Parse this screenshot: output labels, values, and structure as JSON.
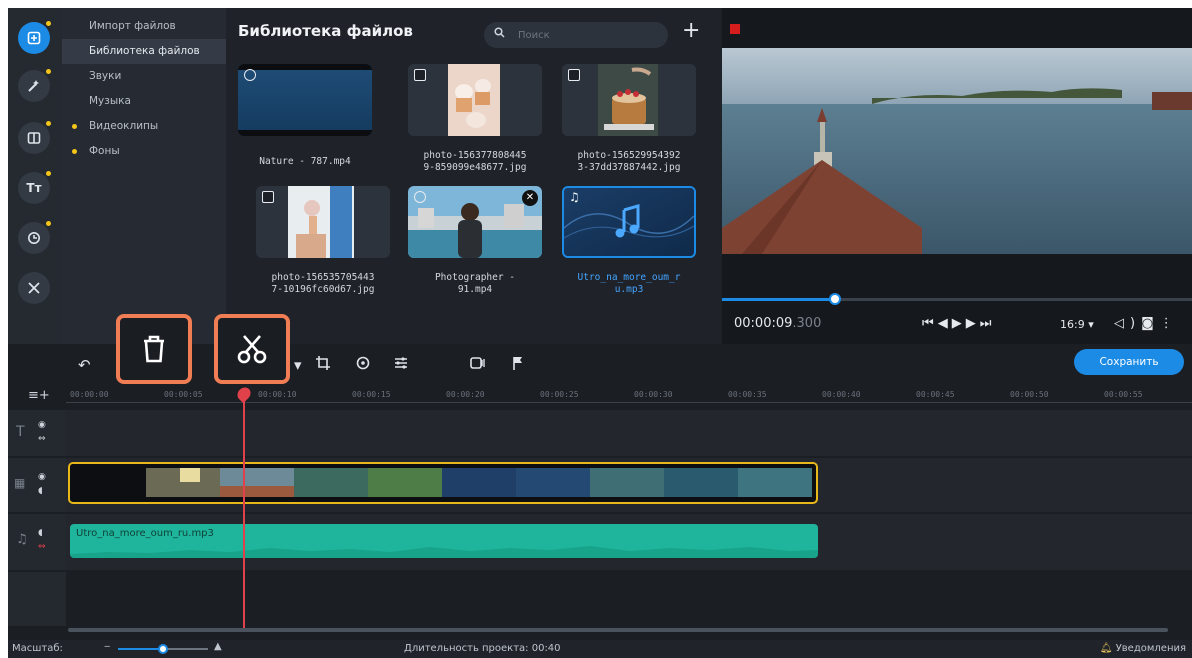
{
  "sidebar": {
    "categories": [
      {
        "label": "Импорт файлов",
        "active": false,
        "bullet": false
      },
      {
        "label": "Библиотека файлов",
        "active": true,
        "bullet": false
      },
      {
        "label": "Звуки",
        "active": false,
        "bullet": false
      },
      {
        "label": "Музыка",
        "active": false,
        "bullet": false
      },
      {
        "label": "Видеоклипы",
        "active": false,
        "bullet": true
      },
      {
        "label": "Фоны",
        "active": false,
        "bullet": true
      }
    ],
    "rail_icons": [
      "import-icon",
      "filters-icon",
      "transitions-icon",
      "titles-icon",
      "stickers-icon",
      "tools-icon"
    ],
    "rail_titles_glyph": "Tт"
  },
  "library": {
    "title": "Библиотека файлов",
    "search_placeholder": "Поиск",
    "add_glyph": "+",
    "files": [
      {
        "name": "Nature - 787.mp4",
        "kind": "video"
      },
      {
        "name": "photo-1563778084459-859099e48677.jpg",
        "kind": "image",
        "line1": "photo-156377808445",
        "line2": "9-859099e48677.jpg"
      },
      {
        "name": "photo-1565299543923-37dd37887442.jpg",
        "kind": "image",
        "line1": "photo-156529954392",
        "line2": "3-37dd37887442.jpg"
      },
      {
        "name": "photo-1565357054437-10196fc60d67.jpg",
        "kind": "image",
        "line1": "photo-156535705443",
        "line2": "7-10196fc60d67.jpg"
      },
      {
        "name": "Photographer - 91.mp4",
        "kind": "video",
        "line1": "Photographer -",
        "line2": "91.mp4"
      },
      {
        "name": "Utro_na_more_oum_ru.mp3",
        "kind": "audio",
        "line1": "Utro_na_more_oum_r",
        "line2": "u.mp3",
        "selected": true
      }
    ]
  },
  "preview": {
    "time_main": "00:00:09",
    "time_ms": ".300",
    "aspect": "16:9 ▾",
    "progress": 0.24
  },
  "timeline": {
    "save_label": "Сохранить",
    "ruler": [
      "00:00:00",
      "00:00:05",
      "00:00:10",
      "00:00:15",
      "00:00:20",
      "00:00:25",
      "00:00:30",
      "00:00:35",
      "00:00:40",
      "00:00:45",
      "00:00:50",
      "00:00:55"
    ],
    "audio_clip_label": "Utro_na_more_oum_ru.mp3"
  },
  "status": {
    "zoom_label": "Масштаб:",
    "zoom_level": 0.5,
    "duration_label": "Длительность проекта: 00:40",
    "notifications_label": "Уведомления"
  },
  "colors": {
    "accent": "#1c8be6",
    "highlight": "#f07d54",
    "clip_border": "#e8b81a",
    "audio_clip": "#1fb59c",
    "playhead": "#e0414a"
  }
}
